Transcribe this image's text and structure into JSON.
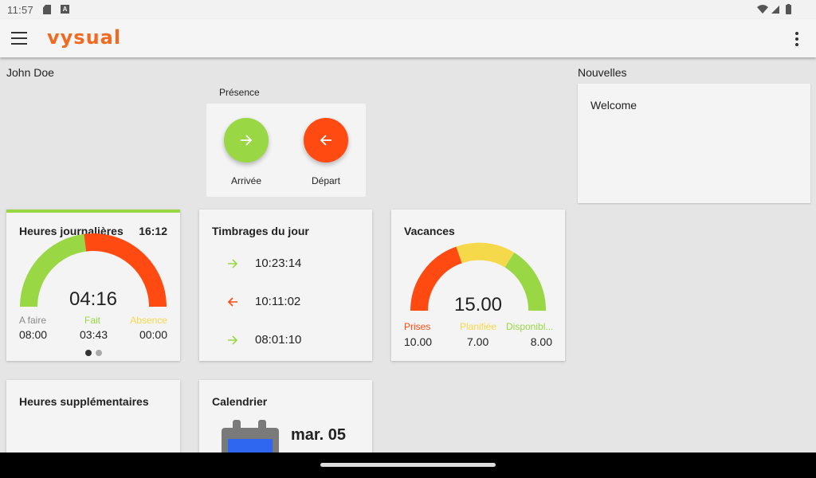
{
  "status_bar": {
    "time": "11:57"
  },
  "app_bar": {
    "logo": "vysual"
  },
  "user": {
    "name": "John Doe"
  },
  "presence": {
    "title": "Présence",
    "arrival_label": "Arrivée",
    "departure_label": "Départ",
    "colors": {
      "arrival": "#99d744",
      "departure": "#ff4b12"
    }
  },
  "news": {
    "title": "Nouvelles",
    "item": "Welcome"
  },
  "daily_hours": {
    "title": "Heures journalières",
    "time": "16:12",
    "center_value": "04:16",
    "labels": {
      "todo": "A faire",
      "done": "Fait",
      "absence": "Absence"
    },
    "values": {
      "todo": "08:00",
      "done": "03:43",
      "absence": "00:00"
    },
    "page_count": 2,
    "active_page": 1
  },
  "stamps": {
    "title": "Timbrages du jour",
    "entries": [
      {
        "direction": "in",
        "time": "10:23:14"
      },
      {
        "direction": "out",
        "time": "10:11:02"
      },
      {
        "direction": "in",
        "time": "08:01:10"
      }
    ]
  },
  "vacations": {
    "title": "Vacances",
    "center_value": "15.00",
    "labels": {
      "taken": "Prises",
      "planned": "Planifiée",
      "available": "Disponibl..."
    },
    "values": {
      "taken": "10.00",
      "planned": "7.00",
      "available": "8.00"
    }
  },
  "overtime": {
    "title": "Heures supplémentaires"
  },
  "calendar": {
    "title": "Calendrier",
    "date": "mar. 05"
  },
  "colors": {
    "orange": "#ff4b12",
    "green": "#99d744",
    "yellow": "#f5d94a",
    "gray_label": "#888888"
  }
}
